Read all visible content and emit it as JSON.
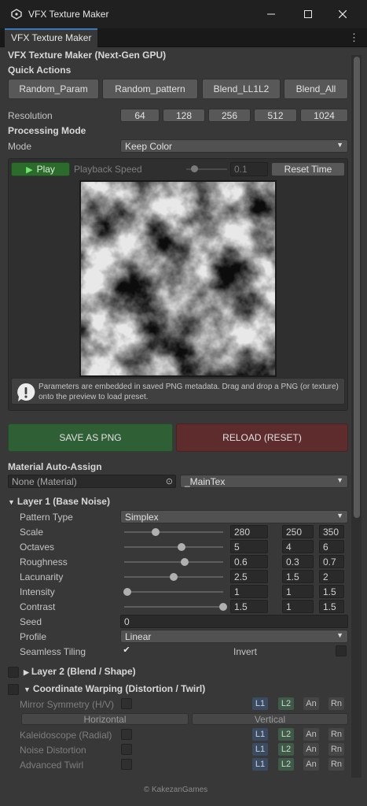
{
  "window": {
    "title": "VFX Texture Maker"
  },
  "tab": {
    "label": "VFX Texture Maker"
  },
  "header": {
    "title": "VFX Texture Maker (Next-Gen GPU)",
    "quick_actions": "Quick Actions"
  },
  "quick_buttons": [
    "Random_Param",
    "Random_pattern",
    "Blend_LL1L2",
    "Blend_All"
  ],
  "resolution": {
    "label": "Resolution",
    "options": [
      "64",
      "128",
      "256",
      "512",
      "1024"
    ]
  },
  "processing": {
    "title": "Processing Mode",
    "mode_label": "Mode",
    "mode_value": "Keep Color"
  },
  "playback": {
    "play": "Play",
    "speed_label": "Playback Speed",
    "speed_value": "0.1",
    "speed_level": 0.2,
    "reset": "Reset Time"
  },
  "info": {
    "text": "Parameters are embedded in saved PNG metadata. Drag and drop a PNG (or texture) onto the preview to load preset."
  },
  "actions": {
    "save": "SAVE AS PNG",
    "reload": "RELOAD (RESET)"
  },
  "material": {
    "title": "Material Auto-Assign",
    "value": "None (Material)",
    "property": "_MainTex"
  },
  "layer1": {
    "title": "Layer 1 (Base Noise)",
    "pattern_label": "Pattern Type",
    "pattern_value": "Simplex",
    "sliders": [
      {
        "label": "Scale",
        "level": 0.32,
        "values": [
          "280",
          "250",
          "350"
        ]
      },
      {
        "label": "Octaves",
        "level": 0.58,
        "values": [
          "5",
          "4",
          "6"
        ]
      },
      {
        "label": "Roughness",
        "level": 0.61,
        "values": [
          "0.6",
          "0.3",
          "0.7"
        ]
      },
      {
        "label": "Lacunarity",
        "level": 0.5,
        "values": [
          "2.5",
          "1.5",
          "2"
        ]
      },
      {
        "label": "Intensity",
        "level": 0.03,
        "values": [
          "1",
          "1",
          "1.5"
        ]
      },
      {
        "label": "Contrast",
        "level": 1.0,
        "values": [
          "1.5",
          "1",
          "1.5"
        ]
      }
    ],
    "seed_label": "Seed",
    "seed_value": "0",
    "profile_label": "Profile",
    "profile_value": "Linear",
    "seamless_label": "Seamless Tiling",
    "invert_label": "Invert"
  },
  "layer2": {
    "title": "Layer 2 (Blend / Shape)"
  },
  "warping": {
    "title": "Coordinate Warping (Distortion / Twirl)",
    "rows": [
      {
        "label": "Mirror Symmetry (H/V)"
      },
      {
        "label": "Kaleidoscope (Radial)"
      },
      {
        "label": "Noise Distortion"
      },
      {
        "label": "Advanced Twirl"
      }
    ],
    "horizontal": "Horizontal",
    "vertical": "Vertical",
    "layer_buttons": [
      "L1",
      "L2",
      "An",
      "Rn"
    ]
  },
  "footer": {
    "text": "© KakezanGames"
  },
  "colors": {
    "save": "#2f5f35",
    "reload": "#5e2c2c",
    "play": "#2d6b2d",
    "accent": "#3a79bb"
  }
}
